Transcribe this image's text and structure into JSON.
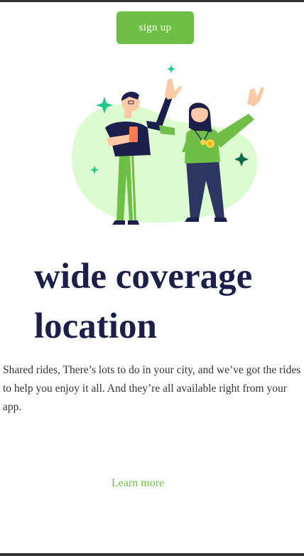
{
  "header": {
    "signup_label": "sign up"
  },
  "hero": {
    "illustration": "two-people-waving-illustration"
  },
  "main": {
    "headline_line1": "wide coverage",
    "headline_line2": "location",
    "description": "Shared rides, There’s lots to do in your city, and we’ve got the rides to help you enjoy it all. And they’re all available right from your app.",
    "learn_more_label": "Learn more"
  },
  "colors": {
    "accent": "#6fbe45",
    "headline": "#1c1f4a",
    "body_text": "#333333",
    "blob": "#dcfbd0",
    "sparkle_light": "#1ec98e",
    "sparkle_dark": "#0f6b4e",
    "frame_edge": "#333333"
  }
}
